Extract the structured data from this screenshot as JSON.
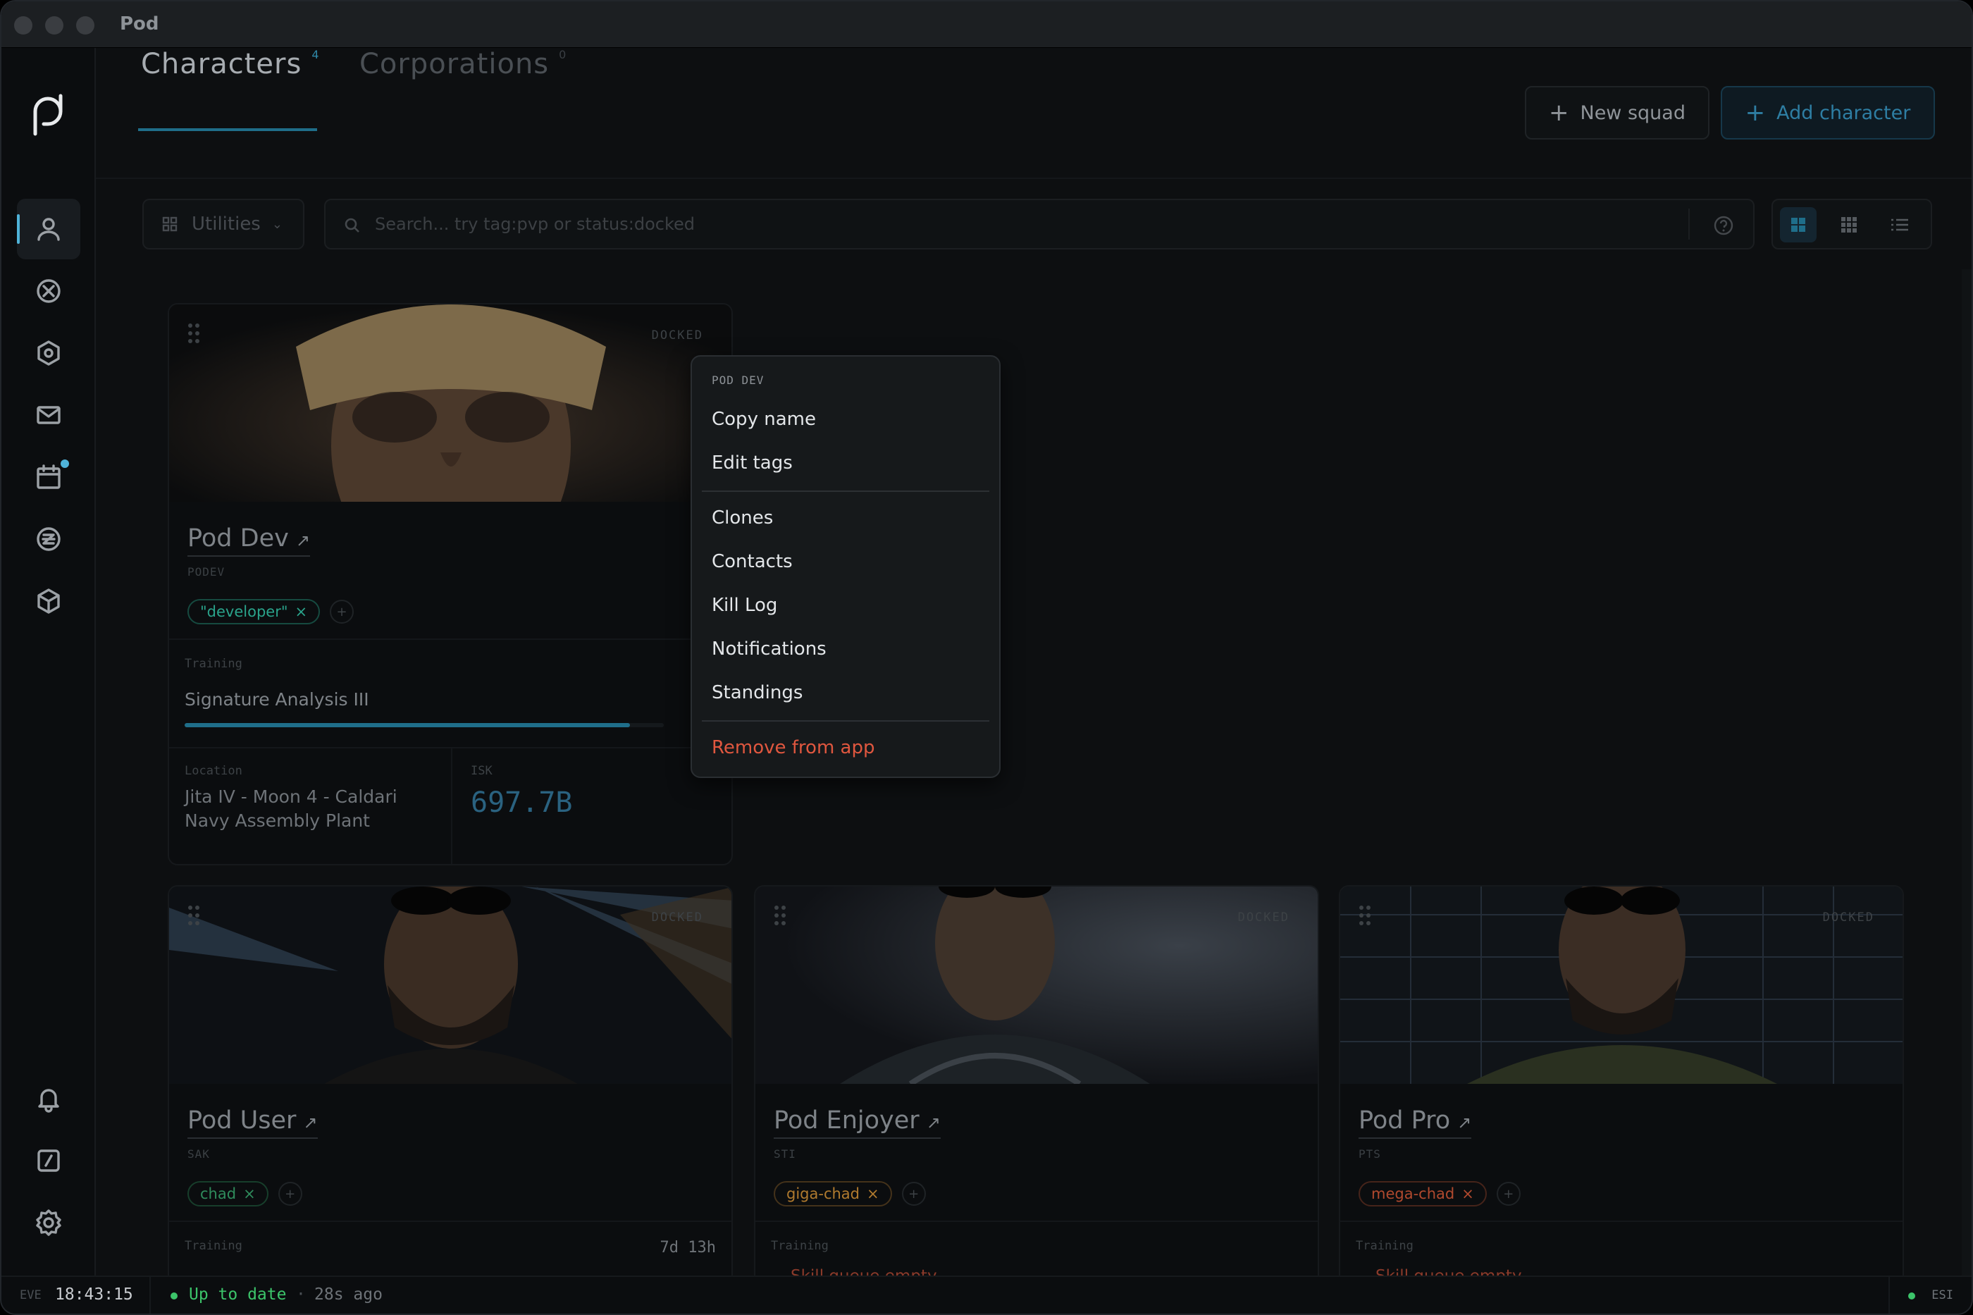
{
  "window": {
    "title": "Pod"
  },
  "tabs": [
    {
      "label": "Characters",
      "count": "4"
    },
    {
      "label": "Corporations",
      "count": "0"
    }
  ],
  "actions": {
    "new_squad": "New squad",
    "add_character": "Add character"
  },
  "toolbar": {
    "utilities_label": "Utilities",
    "search_placeholder": "Search... try tag:pvp or status:docked"
  },
  "sidebar": {
    "items": [
      {
        "icon": "user-icon",
        "active": true
      },
      {
        "icon": "crosshair-icon"
      },
      {
        "icon": "hexagon-icon"
      },
      {
        "icon": "mail-icon"
      },
      {
        "icon": "calendar-icon",
        "badge": true
      },
      {
        "icon": "currency-icon"
      },
      {
        "icon": "box-icon"
      }
    ],
    "bottom": [
      {
        "icon": "bell-icon"
      },
      {
        "icon": "slash-square-icon"
      },
      {
        "icon": "settings-icon"
      }
    ]
  },
  "characters": [
    {
      "name": "Pod Dev",
      "ticker": "PODEV",
      "status": "DOCKED",
      "tags": [
        {
          "label": "\"developer\"",
          "color": "#2aa38b"
        }
      ],
      "training_label": "Training",
      "training": "Signature Analysis III",
      "progress": 0.93,
      "location_label": "Location",
      "location_line1": "Jita IV - Moon 4 - Caldari",
      "location_line2": "Navy Assembly Plant",
      "isk_label": "ISK",
      "isk": "697.7B"
    },
    {
      "name": "Pod User",
      "ticker": "SAK",
      "status": "DOCKED",
      "tags": [
        {
          "label": "chad",
          "color": "#2f8c5c"
        }
      ],
      "training_label": "Training",
      "training_time": "7d 13h"
    },
    {
      "name": "Pod Enjoyer",
      "ticker": "STI",
      "status": "DOCKED",
      "tags": [
        {
          "label": "giga-chad",
          "color": "#b07a2e"
        }
      ],
      "training_label": "Training",
      "training": "Skill queue empty"
    },
    {
      "name": "Pod Pro",
      "ticker": "PTS",
      "status": "DOCKED",
      "tags": [
        {
          "label": "mega-chad",
          "color": "#b0492e"
        }
      ],
      "training_label": "Training",
      "training": "Skill queue empty"
    }
  ],
  "context_menu": {
    "header": "POD DEV",
    "group1": [
      "Copy name",
      "Edit tags"
    ],
    "group2": [
      "Clones",
      "Contacts",
      "Kill Log",
      "Notifications",
      "Standings"
    ],
    "danger": "Remove from app",
    "danger_color": "#e0573f"
  },
  "statusbar": {
    "server_label": "EVE",
    "time": "18:43:15",
    "sync_status": "Up to date",
    "sync_ago": "28s ago",
    "api_label": "ESI",
    "ok_color": "#3cc46a"
  },
  "colors": {
    "accent": "#4fb3d9",
    "bg": "#0d0f11"
  }
}
